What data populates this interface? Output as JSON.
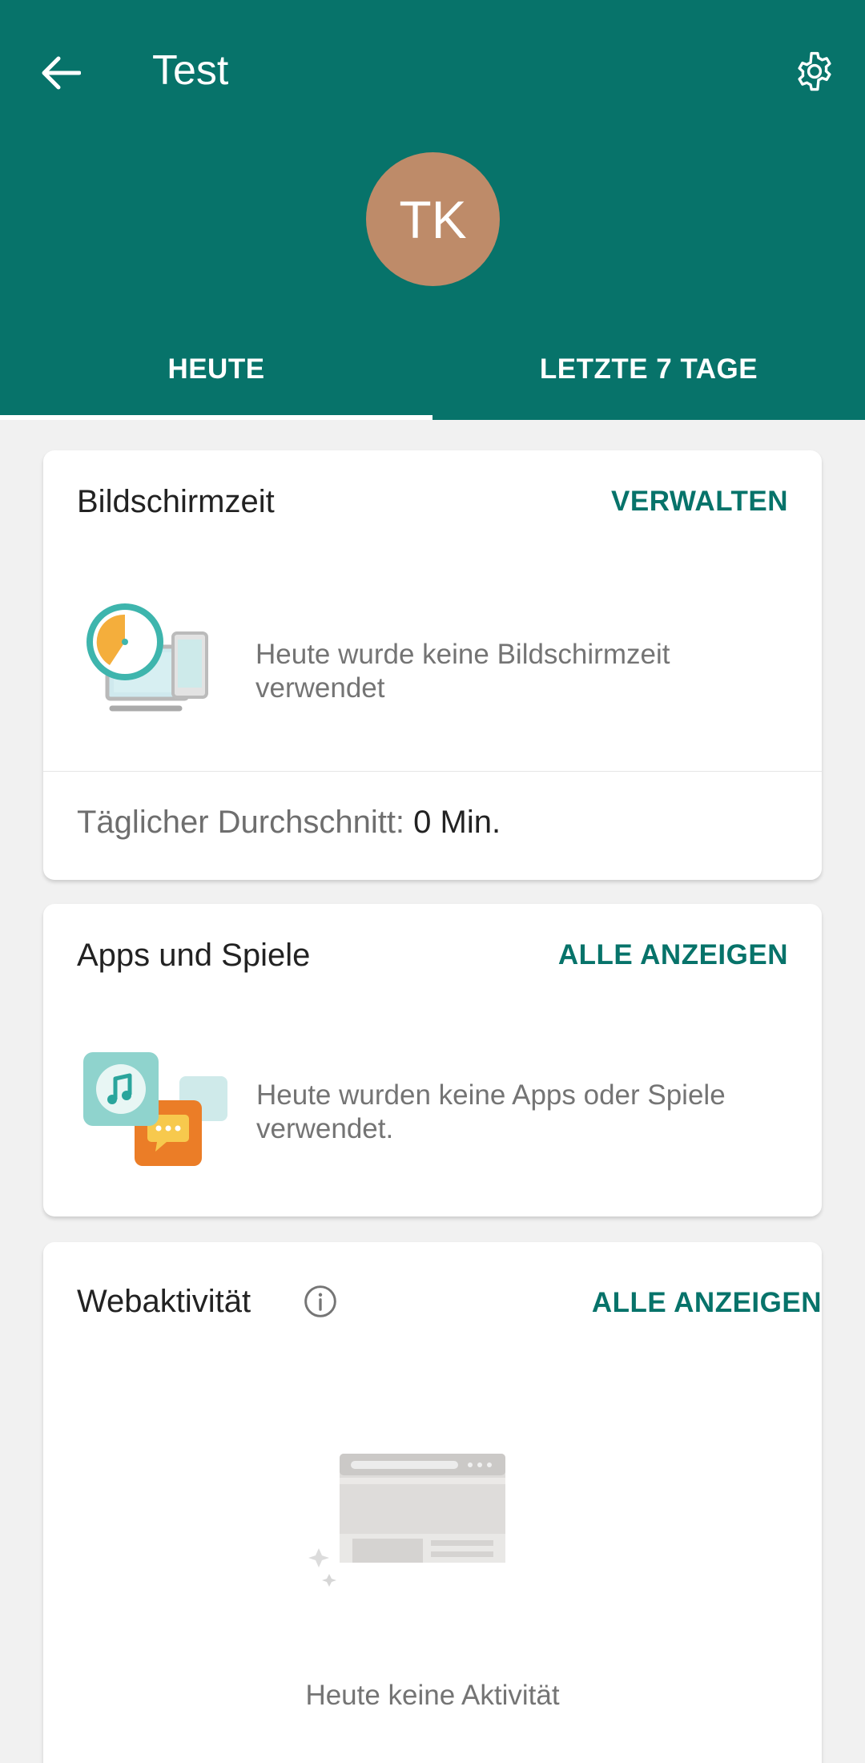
{
  "header": {
    "title": "Test",
    "avatar_initials": "TK",
    "back_icon": "arrow-back-icon",
    "settings_icon": "gear-icon",
    "color": "#07736a",
    "avatar_color": "#be8b69"
  },
  "tabs": [
    {
      "label": "HEUTE",
      "selected": true
    },
    {
      "label": "LETZTE 7 TAGE",
      "selected": false
    }
  ],
  "screen_time": {
    "title": "Bildschirmzeit",
    "action": "VERWALTEN",
    "message": "Heute wurde keine Bildschirmzeit verwendet",
    "avg_label": "Täglicher Durchschnitt:",
    "avg_value": "0 Min.",
    "illustration": "clock-devices-illustration"
  },
  "apps": {
    "title": "Apps und Spiele",
    "action": "ALLE ANZEIGEN",
    "message": "Heute wurden keine Apps oder Spiele verwendet.",
    "illustration": "music-chat-apps-illustration"
  },
  "web": {
    "title": "Webaktivität",
    "action": "ALLE ANZEIGEN",
    "message": "Heute keine Aktivität",
    "info_icon": "info-icon",
    "illustration": "browser-window-illustration"
  }
}
